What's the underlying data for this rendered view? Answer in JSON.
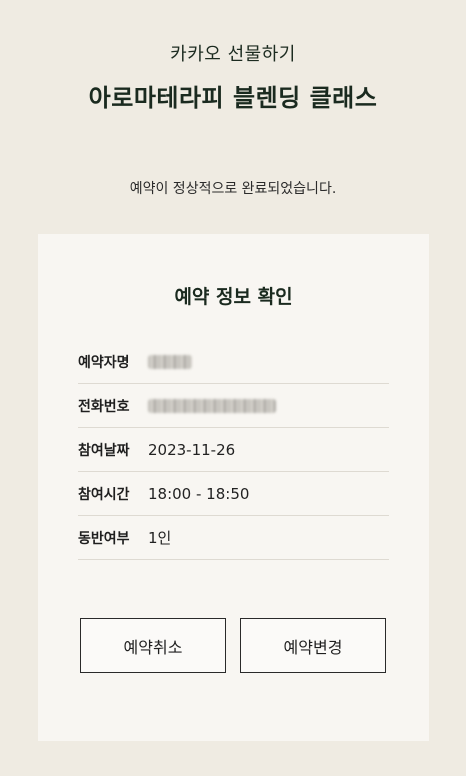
{
  "header": {
    "subtitle": "카카오 선물하기",
    "title": "아로마테라피 블렌딩 클래스"
  },
  "message": "예약이 정상적으로 완료되었습니다.",
  "card": {
    "title": "예약 정보 확인",
    "rows": [
      {
        "label": "예약자명",
        "value": "",
        "redacted": true
      },
      {
        "label": "전화번호",
        "value": "",
        "redacted": true
      },
      {
        "label": "참여날짜",
        "value": "2023-11-26"
      },
      {
        "label": "참여시간",
        "value": "18:00 - 18:50"
      },
      {
        "label": "동반여부",
        "value": "1인"
      }
    ]
  },
  "buttons": {
    "cancel": "예약취소",
    "change": "예약변경"
  },
  "colors": {
    "background": "#efebe2",
    "card": "#f8f6f2",
    "text_dark": "#1a2a1f"
  }
}
